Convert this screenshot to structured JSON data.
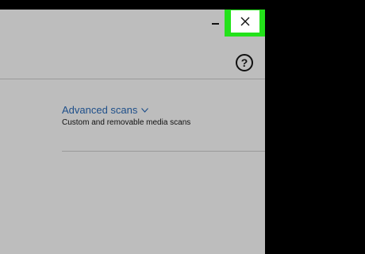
{
  "window": {
    "minimize_icon": "minimize-icon",
    "close_icon": "close-icon",
    "highlight_color": "#23e21a"
  },
  "help": {
    "label": "?"
  },
  "scan_options": {
    "advanced_link": "Advanced scans",
    "advanced_description": "Custom and removable media scans",
    "chevron_icon": "chevron-down-icon",
    "link_color": "#1e4f8a"
  }
}
